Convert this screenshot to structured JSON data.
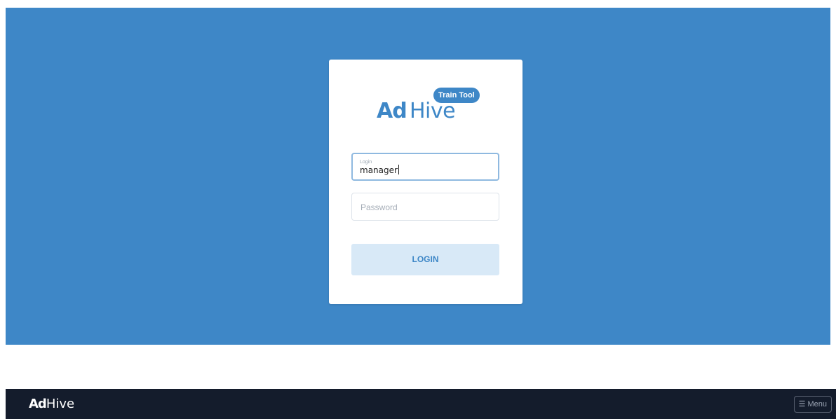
{
  "login_card": {
    "logo": {
      "ad": "Ad",
      "hive": "Hive",
      "badge": "Train Tool"
    },
    "login_field": {
      "label": "Login",
      "value": "manager"
    },
    "password_field": {
      "placeholder": "Password"
    },
    "login_button_label": "LOGIN"
  },
  "navbar": {
    "logo": {
      "ad": "Ad",
      "hive": "Hive"
    },
    "menu_icon": "hamburger-icon",
    "menu_label": "Menu"
  },
  "colors": {
    "brand_blue": "#3e87c7",
    "navbar_bg": "#141c2c",
    "button_bg": "#d8e9f7"
  }
}
